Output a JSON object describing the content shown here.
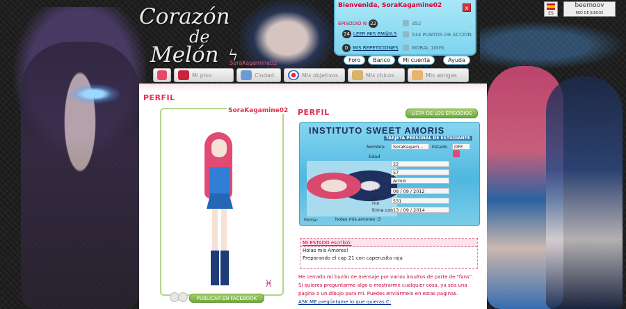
{
  "logo": {
    "line1": "Corazón",
    "line2": "de",
    "line3": "Melón",
    "sub_label": "SoraKagamine02"
  },
  "user_panel": {
    "welcome": "Bienvenida, SoraKagamine02",
    "close_label": "x",
    "episode_label": "EPISODIO N",
    "episode_number": "22",
    "mail_count": "24",
    "mail_link": "LEER MIS EM@ILS",
    "rep_count": "0",
    "rep_link": "MIS REPETICIONES",
    "stat_money": "352",
    "stat_action": "514 PUNTOS DE ACCIÓN",
    "stat_moral": "MORAL 100%",
    "buttons": [
      "Foro",
      "Banco",
      "Mi cuenta",
      "Ayuda"
    ]
  },
  "lang": {
    "code": "ES"
  },
  "partner": {
    "name": "beemoov",
    "tagline": "RED DE JUEGOS"
  },
  "nav": {
    "items": [
      {
        "label": ""
      },
      {
        "label": "Mi piso"
      },
      {
        "label": "Ciudad"
      },
      {
        "label": "Mis objetivos"
      },
      {
        "label": "Mis chicos"
      },
      {
        "label": "Mis amigas"
      }
    ]
  },
  "profile": {
    "title": "PERFIL",
    "username": "SoraKagamine02",
    "facebook_button": "PUBLICAR EN FACEBOOK",
    "zodiac": "♓"
  },
  "profile_right": {
    "title": "PERFIL",
    "episodes_button": "LISTA DE LOS EPISODIOS"
  },
  "card": {
    "title": "INSTITUTO SWEET AMORIS",
    "subtitle": "TARJETA PERSONAL DE ESTUDIANTE",
    "field_name": "Nombre",
    "name_value": "SoraKagam...",
    "field_state": "Estado",
    "state_value": "OFF",
    "field_age": "Edad",
    "age_value": "22",
    "field_rows": [
      "57",
      "Armin",
      "08 / 09 / 2012",
      "531",
      "13 / 09 / 2014"
    ],
    "left_labels": [
      "ch",
      "ch",
      "mo",
      "ltima con"
    ],
    "field_signature": "Firma:",
    "signature_value": "holas mis amores :3"
  },
  "status": {
    "header": "MI ESTADO escribió:",
    "lines": [
      "Holas mis Amores!",
      "Preparando el cap 21 con caperusita roja"
    ]
  },
  "bio": {
    "lines": [
      "He cerrado mi buzón de mensaje por varios insultos de parte de \"fans\".",
      "Si quieres preguntarme algo o mostrarme cualquier cosa, ya sea una",
      "pagina o un dibujo para mí. Puedes enviármelo en estas paginas."
    ],
    "link": "ASK.ME pregúntame lo que quieras C:"
  },
  "colors": {
    "accent_pink": "#e0304f",
    "panel_blue": "#7ed4ef",
    "button_green": "#6ea93a"
  }
}
